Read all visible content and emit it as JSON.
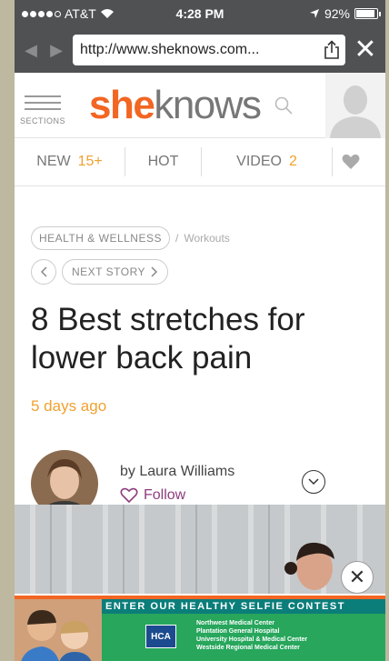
{
  "status": {
    "carrier": "AT&T",
    "time": "4:28 PM",
    "battery": "92%",
    "battery_level": 0.92
  },
  "browser": {
    "url": "http://www.sheknows.com..."
  },
  "header": {
    "sections_label": "SECTIONS",
    "logo_part1": "she",
    "logo_part2": "knows"
  },
  "tabs": [
    {
      "label": "NEW",
      "count": "15+"
    },
    {
      "label": "HOT",
      "count": ""
    },
    {
      "label": "VIDEO",
      "count": "2"
    }
  ],
  "article": {
    "category": "HEALTH & WELLNESS",
    "subcategory": "Workouts",
    "next_story": "NEXT STORY",
    "title": "8 Best stretches for lower back pain",
    "date": "5 days ago",
    "byline": "by Laura Williams",
    "follow": "Follow"
  },
  "ad": {
    "headline": "ENTER OUR HEALTHY SELFIE CONTEST",
    "logo": "HCA",
    "lines": [
      "Northwest Medical Center",
      "Plantation General Hospital",
      "University Hospital & Medical Center",
      "Westside Regional Medical Center"
    ]
  },
  "colors": {
    "brand": "#f26522",
    "accent": "#f0a130",
    "follow": "#8e3c7d",
    "ad_teal": "#0b7e7a",
    "ad_green": "#27a65c"
  }
}
